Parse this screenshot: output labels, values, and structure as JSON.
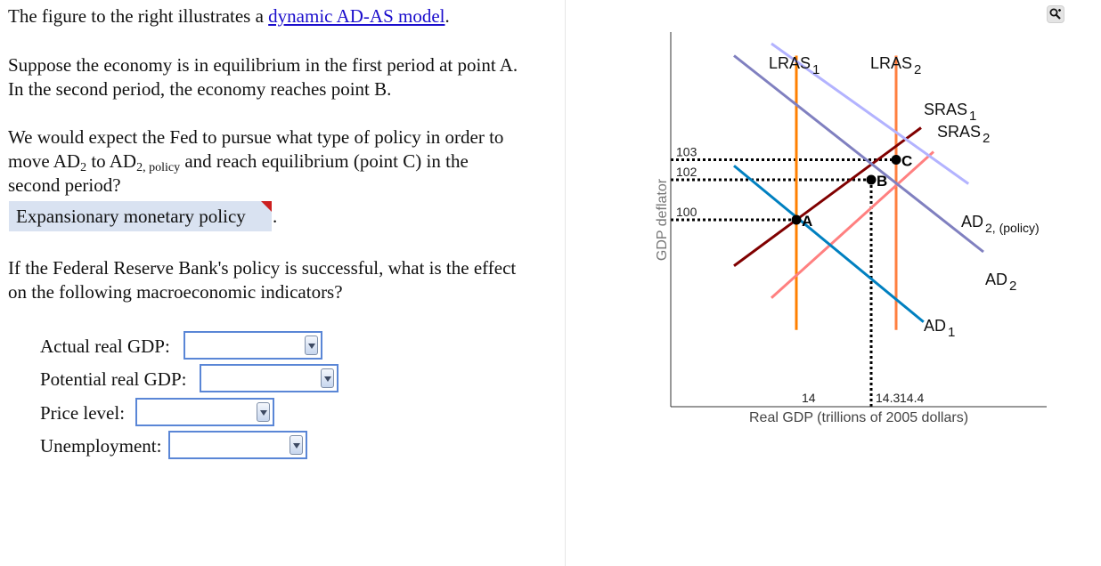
{
  "question": {
    "intro_prefix": "The figure to the right illustrates a ",
    "intro_link": "dynamic AD-AS model",
    "intro_suffix": ".",
    "scenario_line1": "Suppose the economy is in equilibrium in the first period at point A.",
    "scenario_line2": "In the second period, the economy reaches point B.",
    "q1_line1": "We would expect the Fed to pursue what type of policy in order to",
    "q1_line2_a": "move AD",
    "q1_line2_sub1": "2",
    "q1_line2_b": " to AD",
    "q1_line2_sub2": "2, policy",
    "q1_line2_c": " and reach equilibrium (point C) in the",
    "q1_line3": "second period?",
    "q1_answer": "Expansionary monetary policy",
    "q1_answer_suffix": ".",
    "q2_line1": "If the Federal Reserve Bank's policy is successful, what is the effect",
    "q2_line2": "on the following macroeconomic indicators?"
  },
  "indicators": [
    {
      "label": "Actual real GDP:",
      "value": ""
    },
    {
      "label": "Potential real GDP:",
      "value": ""
    },
    {
      "label": "Price level:",
      "value": ""
    },
    {
      "label": "Unemployment:",
      "value": ""
    }
  ],
  "toolbar": {
    "zoom_icon": "magnifier-zoom-icon"
  },
  "chart_data": {
    "type": "line",
    "title": "",
    "xlabel": "Real GDP (trillions of 2005 dollars)",
    "ylabel": "GDP deflator",
    "x_ticks": [
      {
        "value": 14,
        "label": "14"
      },
      {
        "value": 14.3,
        "label": "14.3"
      },
      {
        "value": 14.4,
        "label": "14.4"
      }
    ],
    "y_ticks": [
      {
        "value": 100,
        "label": "100"
      },
      {
        "value": 102,
        "label": "102"
      },
      {
        "value": 103,
        "label": "103"
      }
    ],
    "grid": false,
    "series": [
      {
        "name": "LRAS",
        "sub": "1",
        "kind": "vertical",
        "color": "#ff8000",
        "points": [
          [
            14,
            94.5
          ],
          [
            14,
            108.2
          ]
        ]
      },
      {
        "name": "LRAS",
        "sub": "2",
        "kind": "vertical",
        "color": "#ff7f3f",
        "points": [
          [
            14.4,
            94.5
          ],
          [
            14.4,
            108.2
          ]
        ]
      },
      {
        "name": "SRAS",
        "sub": "1",
        "kind": "line",
        "color": "#800000",
        "points": [
          [
            13.75,
            97.7
          ],
          [
            14.5,
            104.6
          ]
        ]
      },
      {
        "name": "SRAS",
        "sub": "2",
        "kind": "line",
        "color": "#ff8080",
        "points": [
          [
            13.9,
            96.1
          ],
          [
            14.55,
            103.4
          ]
        ]
      },
      {
        "name": "AD",
        "sub": "1",
        "kind": "line",
        "color": "#0080c0",
        "points": [
          [
            13.75,
            102.7
          ],
          [
            14.51,
            94.9
          ]
        ]
      },
      {
        "name": "AD",
        "sub": "2",
        "kind": "line",
        "color": "#8080c0",
        "points": [
          [
            13.75,
            108.2
          ],
          [
            14.75,
            98.4
          ]
        ]
      },
      {
        "name": "AD",
        "sub": "2, (policy)",
        "kind": "line",
        "color": "#b3b3ff",
        "points": [
          [
            13.9,
            108.8
          ],
          [
            14.69,
            101.8
          ]
        ]
      }
    ],
    "points": [
      {
        "label": "A",
        "x": 14,
        "y": 100
      },
      {
        "label": "B",
        "x": 14.3,
        "y": 102
      },
      {
        "label": "C",
        "x": 14.4,
        "y": 103
      }
    ],
    "guides": [
      {
        "from": "y-axis",
        "to": "A"
      },
      {
        "from": "y-axis",
        "to": "B"
      },
      {
        "from": "y-axis",
        "to": "C"
      },
      {
        "from": "x-axis",
        "to": "B"
      }
    ]
  }
}
